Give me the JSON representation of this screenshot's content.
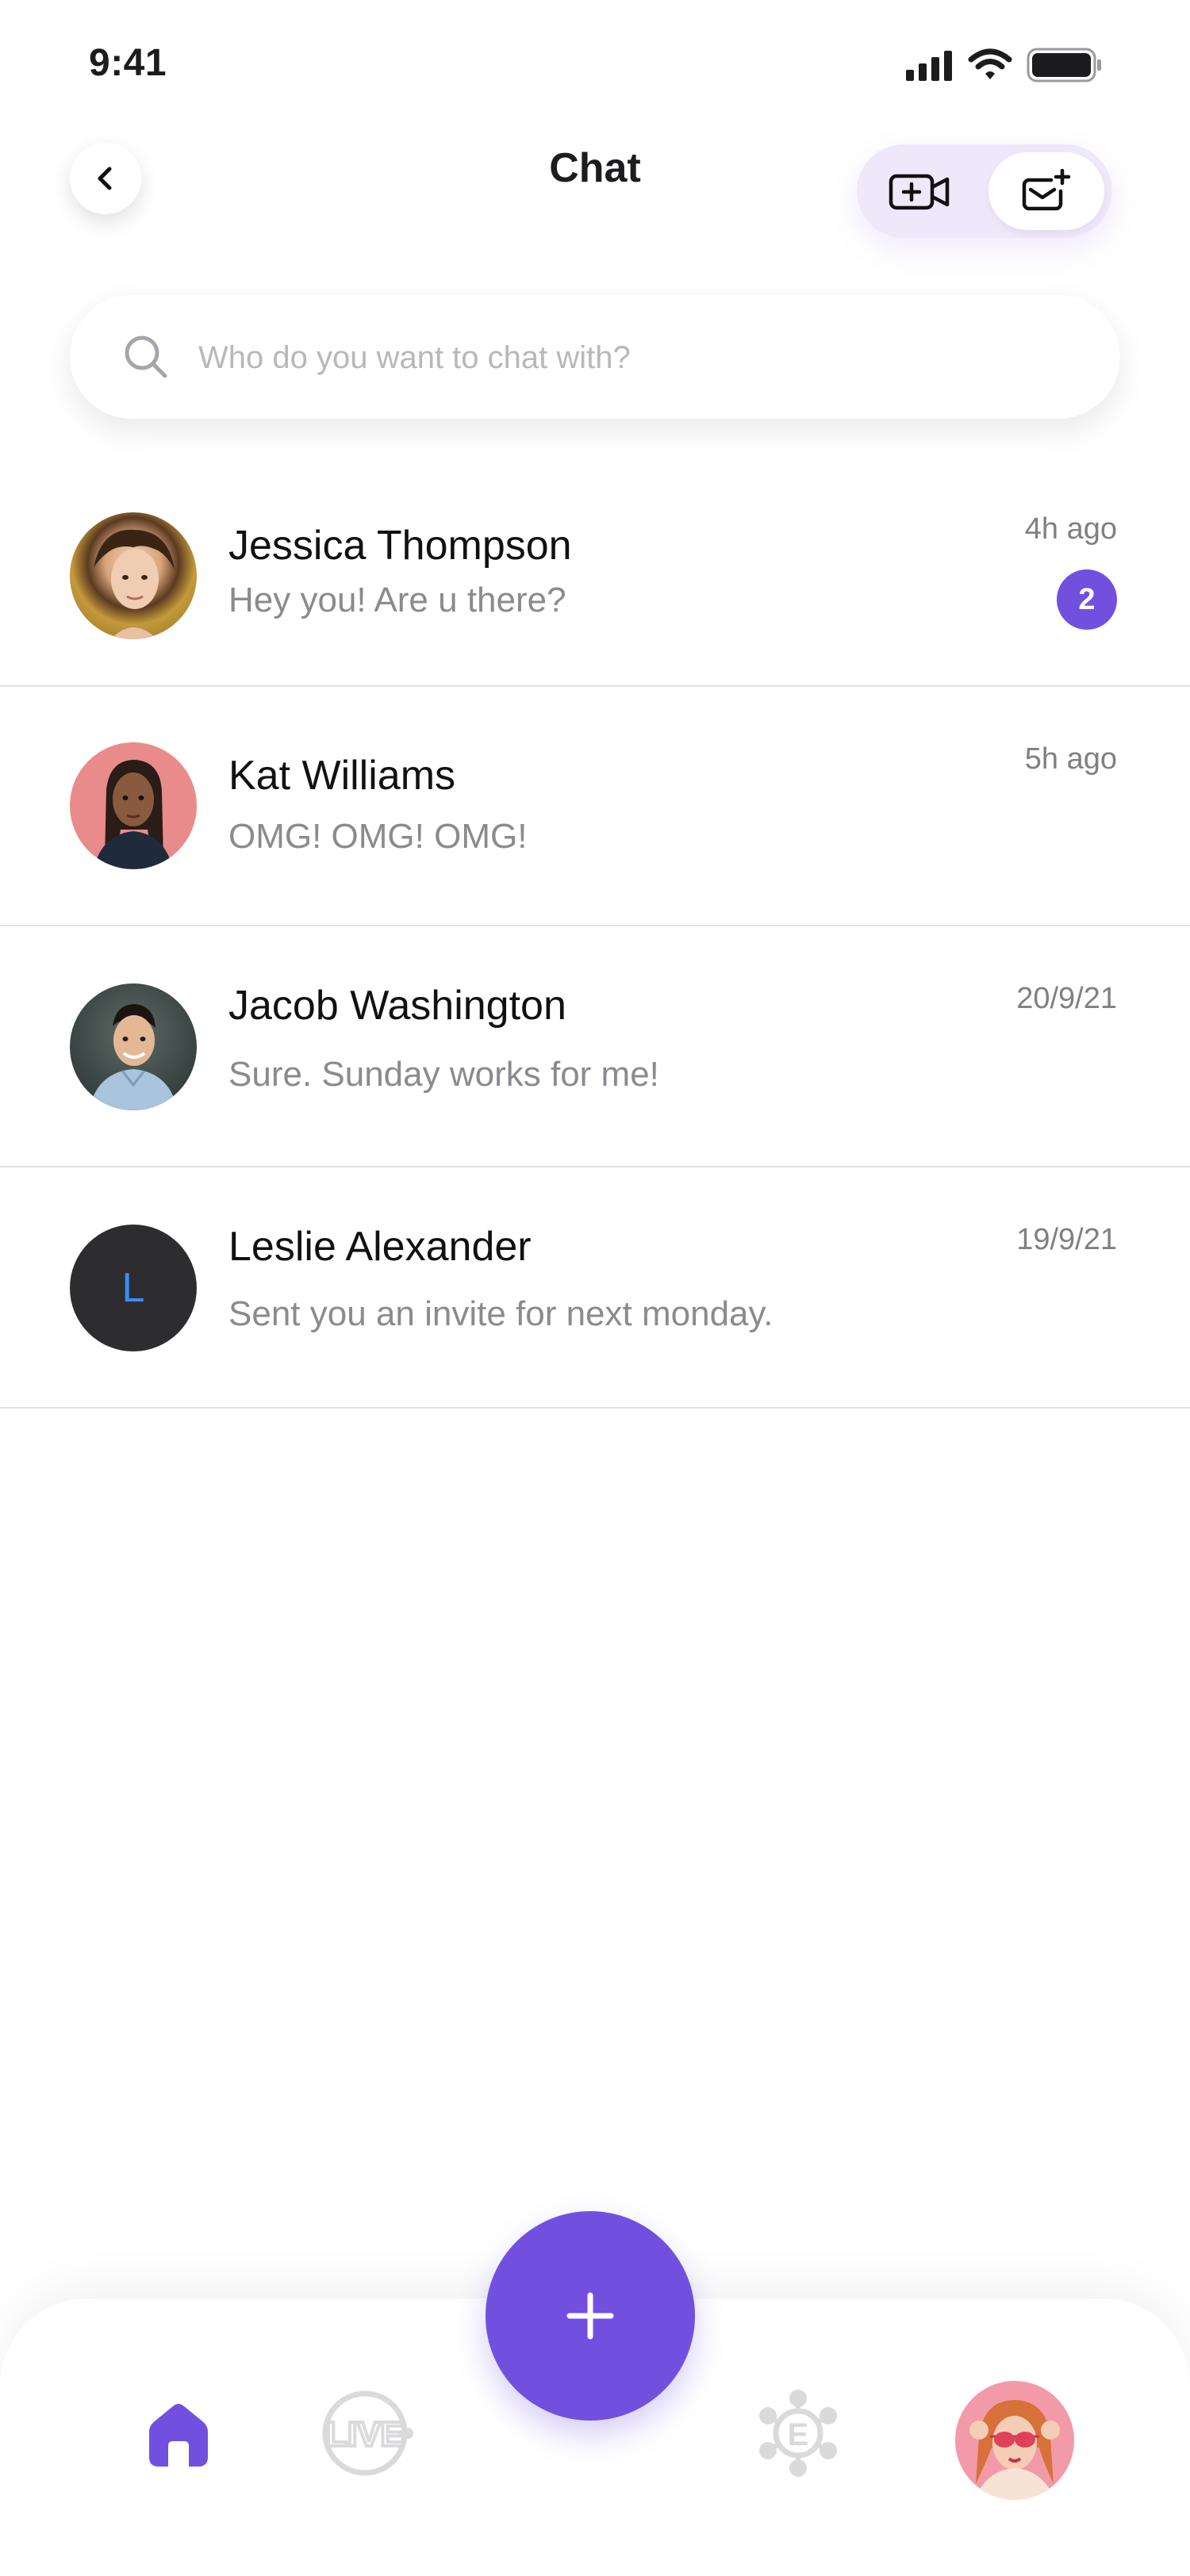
{
  "status_bar": {
    "time": "9:41"
  },
  "header": {
    "title": "Chat"
  },
  "search": {
    "placeholder": "Who do you want to chat with?"
  },
  "chats": [
    {
      "name": "Jessica Thompson",
      "preview": "Hey you! Are u there?",
      "time": "4h ago",
      "unread": "2"
    },
    {
      "name": "Kat Williams",
      "preview": "OMG! OMG! OMG!",
      "time": "5h ago"
    },
    {
      "name": "Jacob Washington",
      "preview": "Sure. Sunday works for me!",
      "time": "20/9/21"
    },
    {
      "name": "Leslie Alexander",
      "preview": "Sent you an invite for next monday.",
      "time": "19/9/21",
      "avatar_initial": "L"
    }
  ],
  "bottom_nav": {
    "items": [
      "home-icon",
      "live-icon",
      "add-icon",
      "events-icon",
      "profile-avatar"
    ],
    "live_label": "LIVE",
    "events_label": "E"
  },
  "colors": {
    "accent": "#7150E0",
    "muted_text": "#8A8A90",
    "divider": "#E2E2E6"
  }
}
